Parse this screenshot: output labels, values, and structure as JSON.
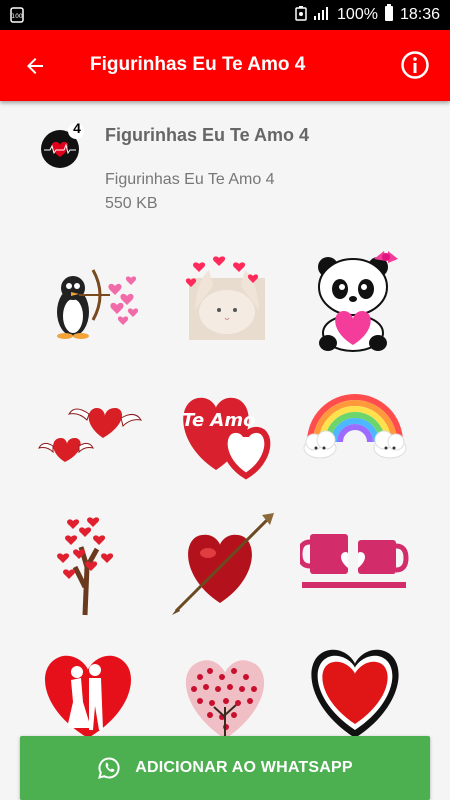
{
  "status_bar": {
    "battery_percent": "100%",
    "time": "18:36"
  },
  "app_bar": {
    "title": "Figurinhas Eu Te Amo 4"
  },
  "pack": {
    "tray_badge": "4",
    "title": "Figurinhas Eu Te Amo 4",
    "name": "Figurinhas Eu Te Amo 4",
    "size": "550 KB"
  },
  "stickers": [
    {
      "name": "penguin-archer-hearts"
    },
    {
      "name": "cat-hands-hearts"
    },
    {
      "name": "panda-with-heart"
    },
    {
      "name": "winged-hearts"
    },
    {
      "name": "te-amo-hearts",
      "text": "Te Amo"
    },
    {
      "name": "rainbow-clouds"
    },
    {
      "name": "heart-tree"
    },
    {
      "name": "heart-with-arrow"
    },
    {
      "name": "pink-mugs"
    },
    {
      "name": "heart-kissing-couple"
    },
    {
      "name": "heart-flower-tree"
    },
    {
      "name": "big-red-heart"
    }
  ],
  "add_button": {
    "label": "ADICIONAR AO WHATSAPP"
  },
  "colors": {
    "app_bar": "#ff0000",
    "add_button": "#4caf50",
    "background": "#f5f5f5"
  }
}
